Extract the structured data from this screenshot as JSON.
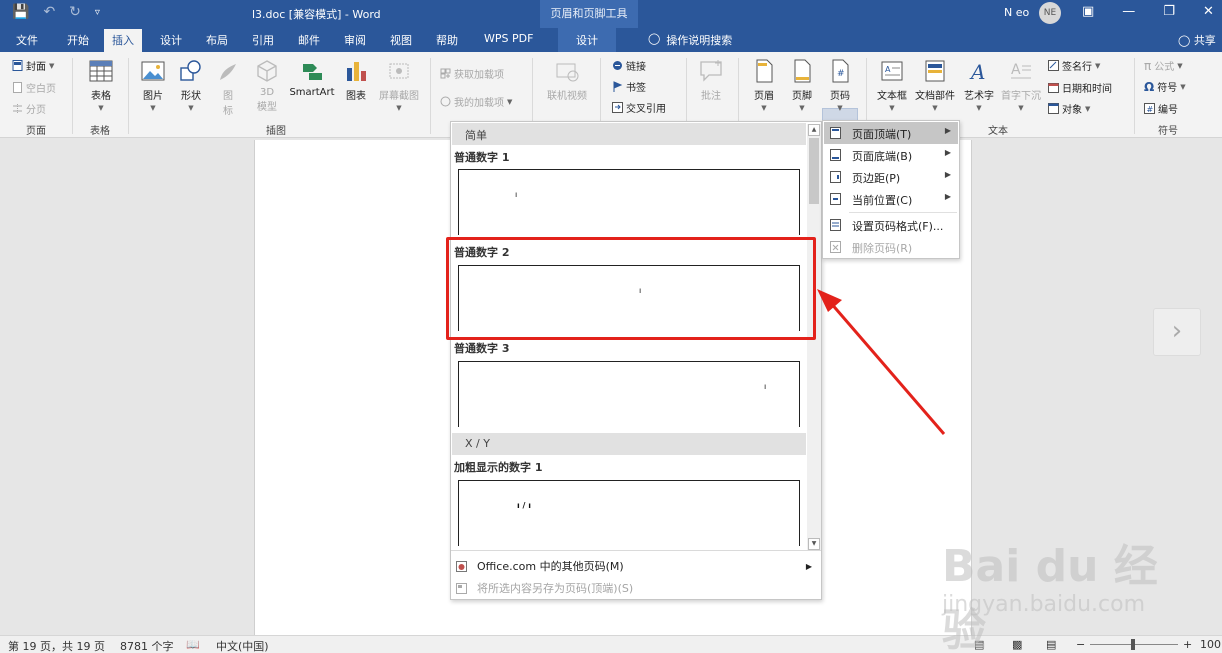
{
  "colors": {
    "accent": "#2b579a",
    "highlight": "#e3221b",
    "context_tab": "#3d6bb0"
  },
  "titlebar": {
    "doc_title": "l3.doc [兼容模式]  -  Word",
    "context_title": "页眉和页脚工具",
    "user": "N eo",
    "avatar_initials": "NE",
    "icons": [
      "save-icon",
      "undo-icon",
      "redo-icon",
      "customize-icon",
      "ribbon-display-icon",
      "minimize-icon",
      "restore-icon",
      "close-icon"
    ]
  },
  "tabs": [
    "文件",
    "开始",
    "插入",
    "设计",
    "布局",
    "引用",
    "邮件",
    "审阅",
    "视图",
    "帮助",
    "WPS PDF"
  ],
  "active_tab": "插入",
  "context_tab": "设计",
  "search": {
    "label": "操作说明搜索"
  },
  "share": "共享",
  "ribbon": {
    "page_group": {
      "label": "页面",
      "cover": "封面",
      "blank": "空白页",
      "break": "分页"
    },
    "table_group": {
      "label": "表格",
      "table": "表格"
    },
    "illustrations": {
      "label": "插图",
      "picture": "图片",
      "shapes": "形状",
      "icons_l1": "图",
      "icons_l2": "标",
      "model_l1": "3D",
      "model_l2": "模型",
      "smartart": "SmartArt",
      "chart": "图表",
      "screenshot": "屏幕截图"
    },
    "addins": {
      "get": "获取加载项",
      "mine": "我的加载项"
    },
    "media": {
      "online_video": "联机视频"
    },
    "links": {
      "link": "链接",
      "bookmark": "书签",
      "cross_ref": "交叉引用"
    },
    "comments": {
      "comment": "批注"
    },
    "header_footer": {
      "header": "页眉",
      "footer": "页脚",
      "page_number": "页码"
    },
    "text_group": {
      "label": "文本",
      "textbox": "文本框",
      "quick_parts": "文档部件",
      "wordart": "艺术字",
      "dropcap": "首字下沉",
      "signature": "签名行",
      "datetime": "日期和时间",
      "object": "对象"
    },
    "symbols": {
      "label": "符号",
      "equation": "公式",
      "symbol": "符号",
      "number": "编号"
    }
  },
  "gallery": {
    "section1": "简单",
    "item1": "普通数字 1",
    "item2": "普通数字 2",
    "item3": "普通数字 3",
    "section2": "X / Y",
    "item4": "加粗显示的数字 1",
    "thumb_pn": "ı",
    "thumb_xy": "ı / ı",
    "more": "Office.com 中的其他页码(M)",
    "save_selection": "将所选内容另存为页码(顶端)(S)"
  },
  "submenu": {
    "top": "页面顶端(T)",
    "bottom": "页面底端(B)",
    "margins": "页边距(P)",
    "current": "当前位置(C)",
    "format": "设置页码格式(F)...",
    "remove": "删除页码(R)"
  },
  "statusbar": {
    "page": "第 19 页，共 19 页",
    "words": "8781 个字",
    "language": "中文(中国)",
    "zoom": "100"
  },
  "watermark": {
    "main": "Bai du 经验",
    "sub": "jingyan.baidu.com"
  }
}
